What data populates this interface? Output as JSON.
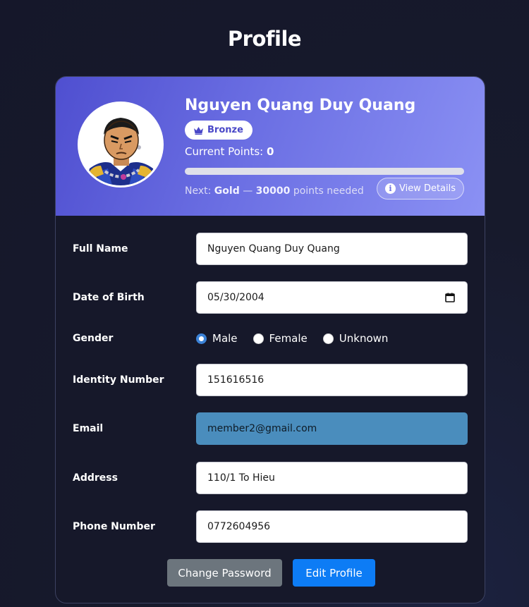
{
  "page": {
    "title": "Profile"
  },
  "header": {
    "name": "Nguyen Quang Duy Quang",
    "tier": "Bronze",
    "points_label": "Current Points:",
    "points_value": "0",
    "progress_fraction": 0,
    "next_prefix": "Next:",
    "next_tier": "Gold",
    "next_separator": "—",
    "next_points": "30000",
    "next_suffix": "points needed",
    "details_button": "View Details",
    "icons": {
      "tier": "crown-icon",
      "details": "info-icon"
    },
    "colors": {
      "gradient_start": "#4f4fd0",
      "gradient_end": "#8b91f4",
      "badge_text": "#4a48c8"
    }
  },
  "form": {
    "full_name": {
      "label": "Full Name",
      "value": "Nguyen Quang Duy Quang"
    },
    "dob": {
      "label": "Date of Birth",
      "value": "05/30/2004"
    },
    "gender": {
      "label": "Gender",
      "options": [
        "Male",
        "Female",
        "Unknown"
      ],
      "selected": "Male"
    },
    "identity": {
      "label": "Identity Number",
      "value": "151616516"
    },
    "email": {
      "label": "Email",
      "value": "member2@gmail.com"
    },
    "address": {
      "label": "Address",
      "value": "110/1 To Hieu"
    },
    "phone": {
      "label": "Phone Number",
      "value": "0772604956"
    }
  },
  "actions": {
    "change_password": "Change Password",
    "edit_profile": "Edit Profile",
    "colors": {
      "secondary": "#6c757d",
      "primary": "#0d7cf5"
    }
  }
}
